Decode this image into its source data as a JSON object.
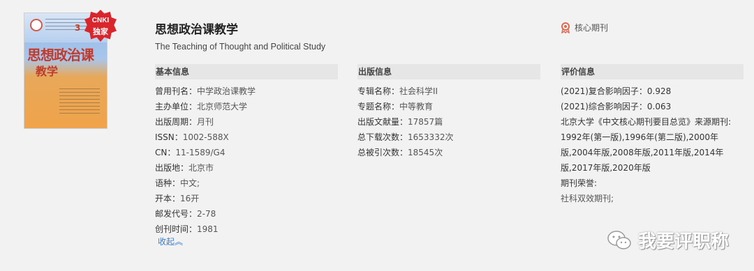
{
  "cover": {
    "badge_line1": "CNKI",
    "badge_line2": "独家",
    "cover_title_line1": "思想政治课",
    "cover_title_line2": "教学",
    "cover_issue": "3"
  },
  "header": {
    "title": "思想政治课教学",
    "subtitle": "The Teaching of Thought and Political Study",
    "core_label": "核心期刊"
  },
  "basic": {
    "heading": "基本信息",
    "rows": [
      {
        "label": "曾用刊名：",
        "value": "中学政治课教学"
      },
      {
        "label": "主办单位：",
        "value": "北京师范大学"
      },
      {
        "label": "出版周期：",
        "value": "月刊"
      },
      {
        "label": "ISSN：",
        "value": "1002-588X"
      },
      {
        "label": "CN：",
        "value": "11-1589/G4"
      },
      {
        "label": "出版地：",
        "value": "北京市"
      },
      {
        "label": "语种：",
        "value": "中文;"
      },
      {
        "label": "开本：",
        "value": "16开"
      },
      {
        "label": "邮发代号：",
        "value": "2-78"
      },
      {
        "label": "创刊时间：",
        "value": "1981"
      }
    ],
    "collapse_label": "收起︽"
  },
  "publish": {
    "heading": "出版信息",
    "rows": [
      {
        "label": "专辑名称：",
        "value": "社会科学II"
      },
      {
        "label": "专题名称：",
        "value": "中等教育"
      },
      {
        "label": "出版文献量：",
        "value": "17857篇"
      },
      {
        "label": "总下载次数：",
        "value": "1653332次"
      },
      {
        "label": "总被引次数：",
        "value": "18545次"
      }
    ]
  },
  "evaluation": {
    "heading": "评价信息",
    "impact1": "(2021)复合影响因子：0.928",
    "impact2": "(2021)综合影响因子：0.063",
    "core_source": "北京大学《中文核心期刊要目总览》来源期刊:",
    "core_years": "1992年(第一版),1996年(第二版),2000年版,2004年版,2008年版,2011年版,2014年版,2017年版,2020年版",
    "honor_label": "期刊荣誉:",
    "honor_value": "社科双效期刊;"
  },
  "watermark": {
    "text": "我要评职称"
  }
}
